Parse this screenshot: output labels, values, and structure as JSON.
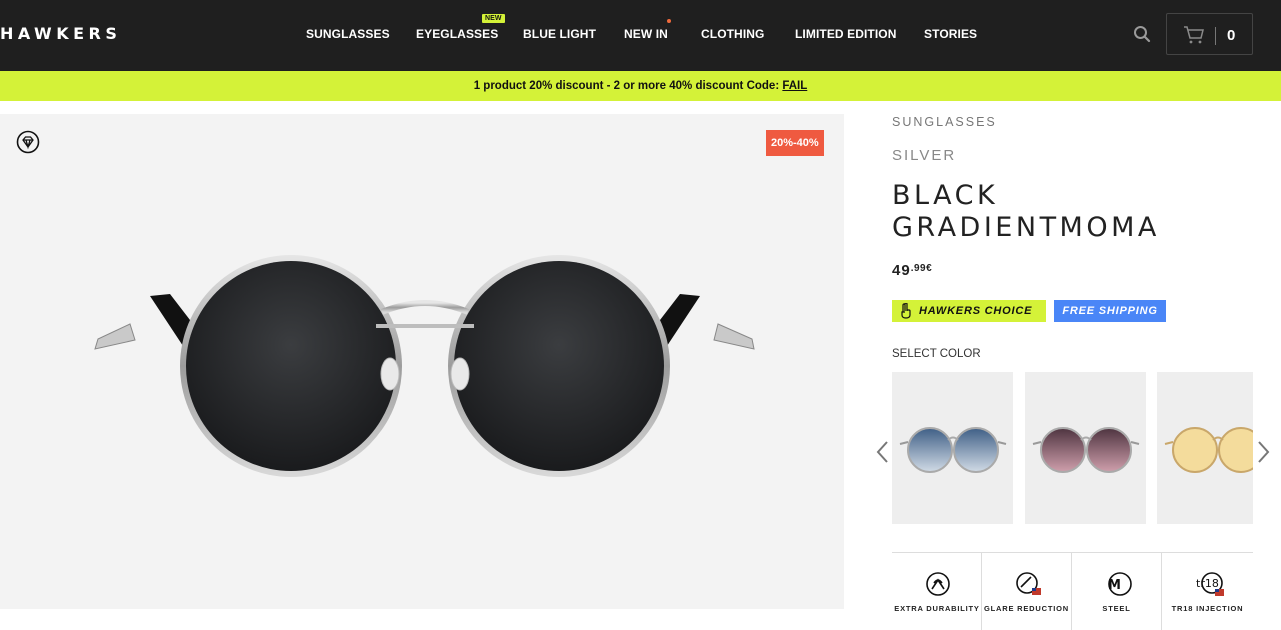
{
  "brand": "HAWKERS",
  "nav": [
    {
      "label": "SUNGLASSES"
    },
    {
      "label": "EYEGLASSES",
      "badge": "NEW"
    },
    {
      "label": "BLUE LIGHT"
    },
    {
      "label": "NEW IN",
      "dot": true
    },
    {
      "label": "CLOTHING"
    },
    {
      "label": "LIMITED EDITION"
    },
    {
      "label": "STORIES"
    }
  ],
  "cart": {
    "count": "0",
    "icon": "cart-icon"
  },
  "search_icon": "search-icon",
  "promo": {
    "text": "1 product 20% discount - 2 or more 40% discount Code: ",
    "code": "FAIL"
  },
  "gallery": {
    "discount_tag": "20%-40%",
    "badge_icon": "diamond-icon"
  },
  "product": {
    "category": "SUNGLASSES",
    "variant": "SILVER",
    "name": "BLACK GRADIENTMOMA",
    "price_int": "49",
    "price_dec": ".99€",
    "badges": {
      "choice": "HAWKERS CHOICE",
      "shipping": "FREE SHIPPING"
    },
    "select_color_label": "SELECT COLOR",
    "swatches": [
      {
        "lens": "#5d7fa8",
        "lens2": "#c9d5e0"
      },
      {
        "lens": "#6b4a55",
        "lens2": "#c79aa6"
      },
      {
        "lens": "#f3d68f",
        "lens2": "#f6e6b5"
      }
    ],
    "features": [
      {
        "label": "EXTRA DURABILITY",
        "icon": "durability-icon"
      },
      {
        "label": "GLARE REDUCTION",
        "icon": "glare-reduction-icon"
      },
      {
        "label": "STEEL",
        "icon": "steel-icon"
      },
      {
        "label": "TR18 INJECTION",
        "icon": "tr18-icon"
      }
    ]
  },
  "colors": {
    "accent": "#d4f238",
    "header": "#1f1f1f",
    "discount": "#ef5a40",
    "shipping": "#4a86f7"
  }
}
